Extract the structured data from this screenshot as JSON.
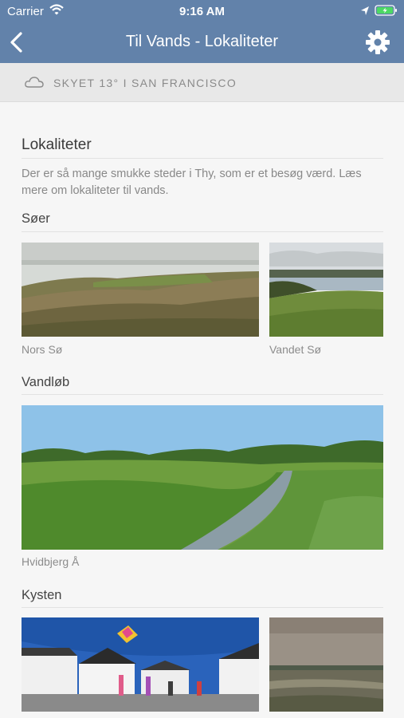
{
  "status": {
    "carrier": "Carrier",
    "time": "9:16 AM"
  },
  "nav": {
    "title": "Til Vands - Lokaliteter"
  },
  "weather": {
    "text": "SKYET 13° I SAN FRANCISCO",
    "icon": "cloud-icon"
  },
  "page": {
    "title": "Lokaliteter",
    "intro": "Der er så mange smukke steder i Thy, som er et besøg værd. Læs mere om lokaliteter til vands."
  },
  "sections": {
    "lakes": {
      "heading": "Søer",
      "items": [
        "Nors Sø",
        "Vandet Sø"
      ]
    },
    "streams": {
      "heading": "Vandløb",
      "items": [
        "Hvidbjerg Å"
      ]
    },
    "coast": {
      "heading": "Kysten"
    }
  },
  "colors": {
    "header": "#6282aa",
    "background": "#f6f6f6",
    "weather_bar": "#e8e8e8"
  }
}
